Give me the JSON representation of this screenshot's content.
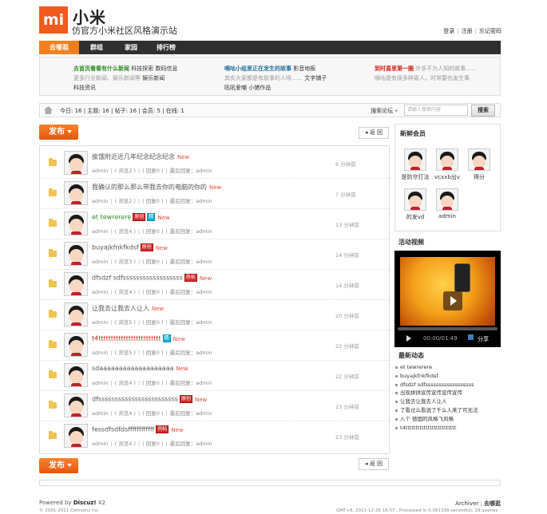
{
  "header": {
    "logo_text": "mi",
    "site_name": "小米",
    "site_subtitle": "仿官方小米社区风格演示站",
    "links": [
      "登录",
      "注册",
      "忘记密码"
    ]
  },
  "nav": [
    "去哪逛",
    "群组",
    "家园",
    "排行榜"
  ],
  "news": {
    "col1": {
      "title": "去首页看看有什么新闻",
      "links": [
        "科技探索",
        "数码信息"
      ],
      "desc": "更多行业新闻、娱乐新闻等",
      "links2": [
        "娱乐新闻",
        "科技资讯"
      ]
    },
    "col2": {
      "title": "嘀咕小组里正在发生的故事",
      "links": [
        "影音地板"
      ],
      "desc": "其实大家都是有故事的人呀……",
      "links2": [
        "文字铺子",
        "吼吼爱嘲",
        "小猪作品"
      ]
    },
    "col3": {
      "title": "到时喜里第一圈",
      "desc": "许多不为人知的故事……",
      "desc2": "嘀咕是有很多种喜人，时常要也发生事"
    }
  },
  "stats": {
    "text": "今日: 16 | 主题: 16 | 帖子: 16 | 会员: 5 | 在线: 1",
    "search_label": "搜索论坛",
    "search_placeholder": "请输入搜索内容",
    "search_button": "搜索"
  },
  "buttons": {
    "post": "发布",
    "back": "返 回"
  },
  "threads": [
    {
      "title": "挨饿附近近几年纪念纪念纪念",
      "badge": "",
      "style": "",
      "meta": "admin",
      "views": "浏览2",
      "replies": "回复0",
      "last": "最后回复：admin",
      "time": "6 分钟前"
    },
    {
      "title": "我确认的那么那么带我去你的电脑的你的",
      "badge": "",
      "style": "",
      "meta": "admin",
      "views": "浏览2",
      "replies": "回复0",
      "last": "最后回复：admin",
      "time": "7 分钟前"
    },
    {
      "title": "et tewrerere",
      "badge": "原创",
      "badge2": "精",
      "style": "green",
      "meta": "admin",
      "views": "浏览4",
      "replies": "回复0",
      "last": "最后回复：admin",
      "time": "13 分钟前"
    },
    {
      "title": "buyajkfnkfkdsf",
      "badge": "原创",
      "style": "",
      "meta": "admin",
      "views": "浏览3",
      "replies": "回复0",
      "last": "最后回复：admin",
      "time": "14 分钟前"
    },
    {
      "title": "dfsdzf sdfssssssssssssssssss",
      "badge": "热帖",
      "style": "",
      "meta": "admin",
      "views": "浏览4",
      "replies": "回复0",
      "last": "最后回复：admin",
      "time": "14 分钟前"
    },
    {
      "title": "让我去让我去人让人",
      "badge": "",
      "style": "",
      "meta": "admin",
      "views": "浏览5",
      "replies": "回复0",
      "last": "最后回复：admin",
      "time": "20 分钟前"
    },
    {
      "title": "t4ttttttttttttttttttttttttt",
      "badge": "",
      "badge2": "精",
      "style": "red",
      "meta": "admin",
      "views": "浏览5",
      "replies": "回复0",
      "last": "最后回复：admin",
      "time": "22 分钟前"
    },
    {
      "title": "sdaaaaaaaaaaaaaaaaaaa",
      "badge": "",
      "style": "",
      "meta": "admin",
      "views": "浏览4",
      "replies": "回复0",
      "last": "最后回复：admin",
      "time": "22 分钟前"
    },
    {
      "title": "dfssssssssssssssssssssssss",
      "badge": "原创",
      "style": "",
      "meta": "admin",
      "views": "浏览4",
      "replies": "回复0",
      "last": "最后回复：admin",
      "time": "23 分钟前"
    },
    {
      "title": "fessdfsdfdsffffffffffff",
      "badge": "热帖",
      "style": "",
      "meta": "admin",
      "views": "浏览4",
      "replies": "回复0",
      "last": "最后回复：admin",
      "time": "23 分钟前"
    }
  ],
  "new_label": "New",
  "sidebar": {
    "members_title": "新鲜会员",
    "members": [
      "是防守打法",
      "vcxxb出v",
      "得分",
      "的发vd",
      "admin"
    ],
    "video_title": "活动视频",
    "video_time": "00:00/01:49",
    "video_share": "分享",
    "news_title": "最新动态",
    "news_items": [
      "et tewrerere",
      "buyajkfnkfkdsf",
      "dfsdzf sdfssssssssssssssssss",
      "出现拼拼宣传宣传宣传宣传",
      "让我去让我去人让人",
      "了看过么看说了千么人来了可无法",
      "入个 德国的风格飞风格",
      "t4ttttttttttttttttttttttttt"
    ]
  },
  "footer": {
    "powered_prefix": "Powered by",
    "powered_brand": "Discuz!",
    "powered_version": "X2",
    "copyright": "© 2001-2011 Comsenz Inc.",
    "links": [
      "Archiver",
      "去哪逛"
    ],
    "gmt": "GMT+8, 2011-12-26 16:57 , Processed in 0.061339 second(s), 19 queries ."
  }
}
